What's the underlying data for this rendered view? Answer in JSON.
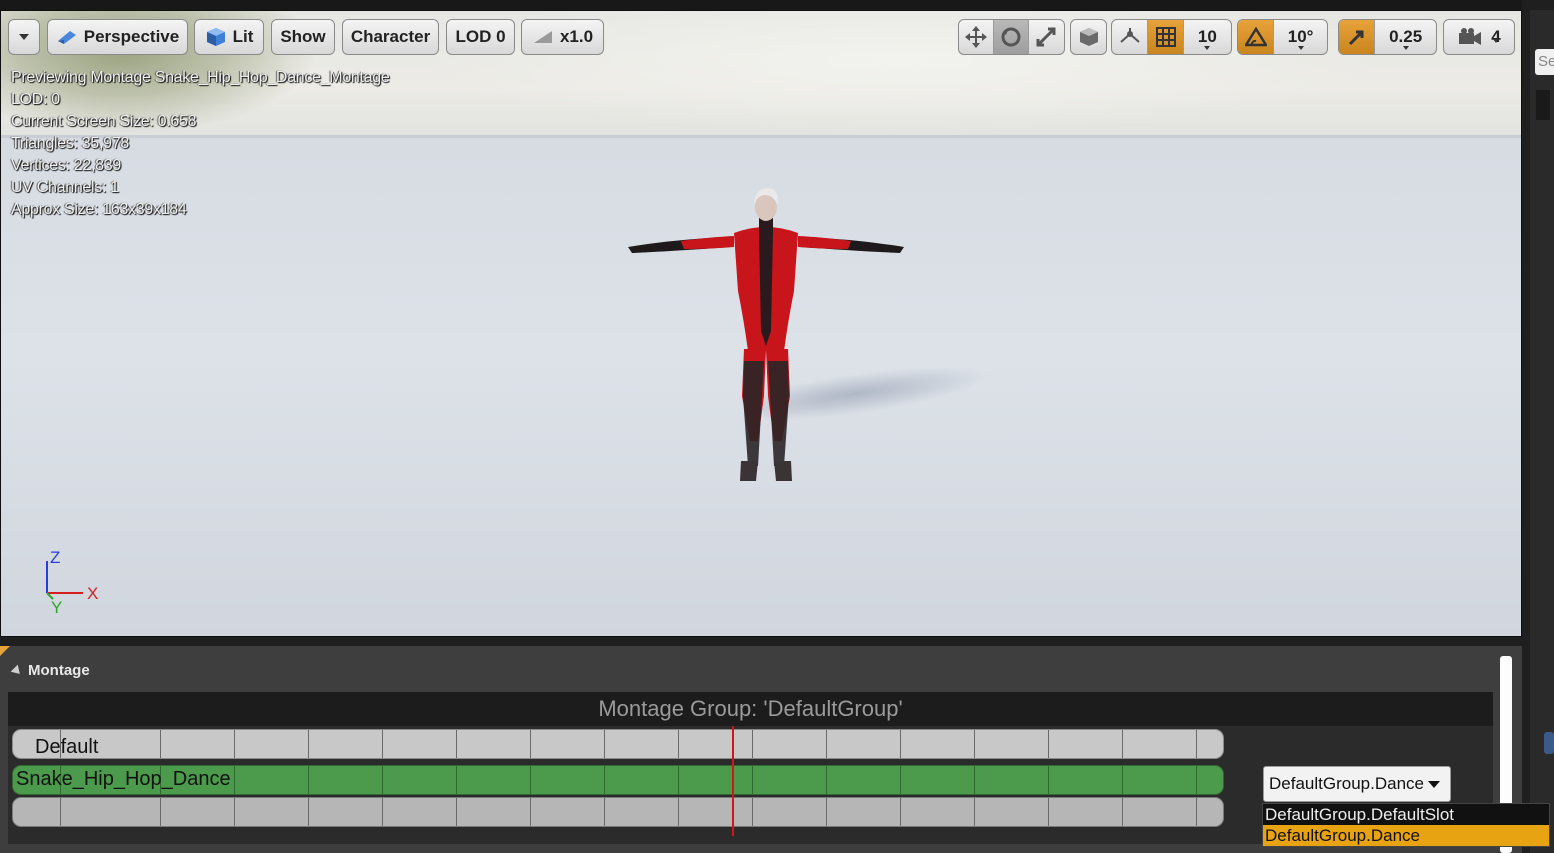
{
  "toolbar": {
    "menu_label": "",
    "perspective_label": "Perspective",
    "lit_label": "Lit",
    "show_label": "Show",
    "character_label": "Character",
    "lod_label": "LOD 0",
    "speed_label": "x1.0",
    "grid_snap_value": "10",
    "rotation_snap_value": "10°",
    "scale_snap_value": "0.25",
    "camera_speed_value": "4"
  },
  "stats": {
    "previewing": "Previewing Montage Snake_Hip_Hop_Dance_Montage",
    "lod": "LOD: 0",
    "screen_size": "Current Screen Size: 0.658",
    "triangles": "Triangles: 35,978",
    "vertices": "Vertices: 22,839",
    "uv_channels": "UV Channels: 1",
    "approx_size": "Approx Size: 163x39x184"
  },
  "gizmo": {
    "z": "Z",
    "x": "X",
    "y": "Y"
  },
  "right_panel": {
    "search_placeholder": "Se"
  },
  "montage": {
    "panel_title": "Montage",
    "group_header": "Montage Group: 'DefaultGroup'",
    "section_label": "Default",
    "anim_label": "Snake_Hip_Hop_Dance",
    "slot_selected": "DefaultGroup.Dance",
    "slot_options": [
      "DefaultGroup.DefaultSlot",
      "DefaultGroup.Dance"
    ]
  },
  "colors": {
    "accent": "#e8a23a",
    "track_green": "#4c9a4c",
    "playhead": "#d01818"
  }
}
